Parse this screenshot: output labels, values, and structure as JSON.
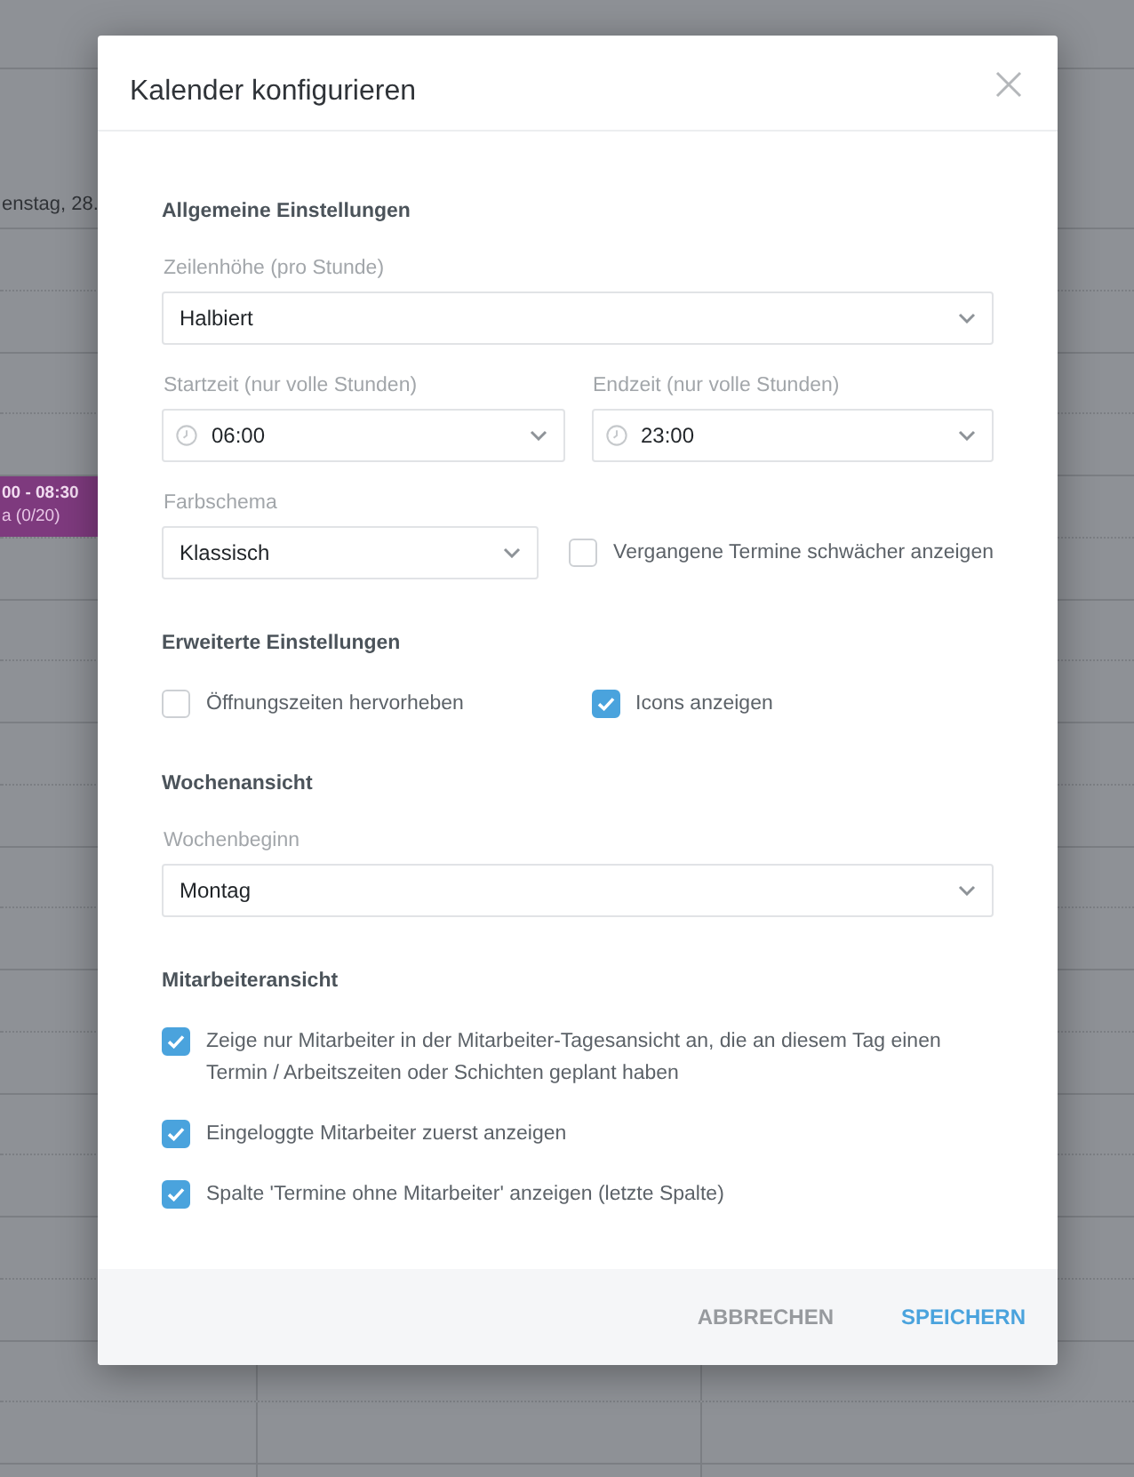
{
  "background_calendar": {
    "day_header": "enstag, 28.",
    "event": {
      "time": "00 - 08:30",
      "title": "a (0/20)"
    }
  },
  "dialog": {
    "title": "Kalender konfigurieren",
    "sections": [
      {
        "title": "Allgemeine Einstellungen",
        "rows": [
          [
            {
              "kind": "select",
              "label": "Zeilenhöhe (pro Stunde)",
              "value": "Halbiert"
            }
          ],
          [
            {
              "kind": "time_select",
              "label": "Startzeit (nur volle Stunden)",
              "value": "06:00"
            },
            {
              "kind": "time_select",
              "label": "Endzeit (nur volle Stunden)",
              "value": "23:00"
            }
          ],
          [
            {
              "kind": "select",
              "label": "Farbschema",
              "value": "Klassisch"
            },
            {
              "kind": "checkbox",
              "label": "Vergangene Termine schwächer anzeigen",
              "checked": false
            }
          ]
        ]
      },
      {
        "title": "Erweiterte Einstellungen",
        "rows": [
          [
            {
              "kind": "checkbox",
              "label": "Öffnungszeiten hervorheben",
              "checked": false
            },
            {
              "kind": "checkbox",
              "label": "Icons anzeigen",
              "checked": true
            }
          ]
        ]
      },
      {
        "title": "Wochenansicht",
        "rows": [
          [
            {
              "kind": "select",
              "label": "Wochenbeginn",
              "value": "Montag"
            }
          ]
        ]
      },
      {
        "title": "Mitarbeiteransicht",
        "rows": [
          [
            {
              "kind": "checkbox",
              "label": "Zeige nur Mitarbeiter in der Mitarbeiter-Tagesansicht an, die an diesem Tag einen Termin / Arbeitszeiten oder Schichten geplant haben",
              "checked": true
            }
          ],
          [
            {
              "kind": "checkbox",
              "label": "Eingeloggte Mitarbeiter zuerst anzeigen",
              "checked": true
            }
          ],
          [
            {
              "kind": "checkbox",
              "label": "Spalte 'Termine ohne Mitarbeiter' anzeigen (letzte Spalte)",
              "checked": true
            }
          ]
        ]
      }
    ],
    "buttons": [
      {
        "kind": "secondary",
        "label": "ABBRECHEN"
      },
      {
        "kind": "primary",
        "label": "SPEICHERN"
      }
    ]
  }
}
